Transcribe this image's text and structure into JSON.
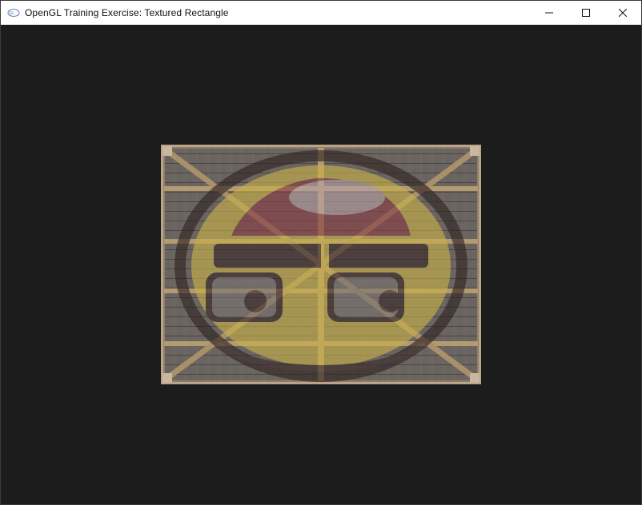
{
  "window": {
    "title": "OpenGL Training Exercise: Textured Rectangle",
    "app_icon": "opengl-logo-icon",
    "buttons": {
      "minimize_icon": "minimize-icon",
      "maximize_icon": "maximize-icon",
      "close_icon": "close-icon"
    }
  },
  "viewport": {
    "clear_color": "#1c1c1c",
    "quad": {
      "texture": "wooden-container",
      "overlay": "smiley-face",
      "wood_color": "#6f6a66",
      "beam_color": "#b49a70",
      "overlay_yellow": "#c9b24a",
      "overlay_dark": "#3a2a2a",
      "overlay_red": "#8a3f47"
    }
  }
}
